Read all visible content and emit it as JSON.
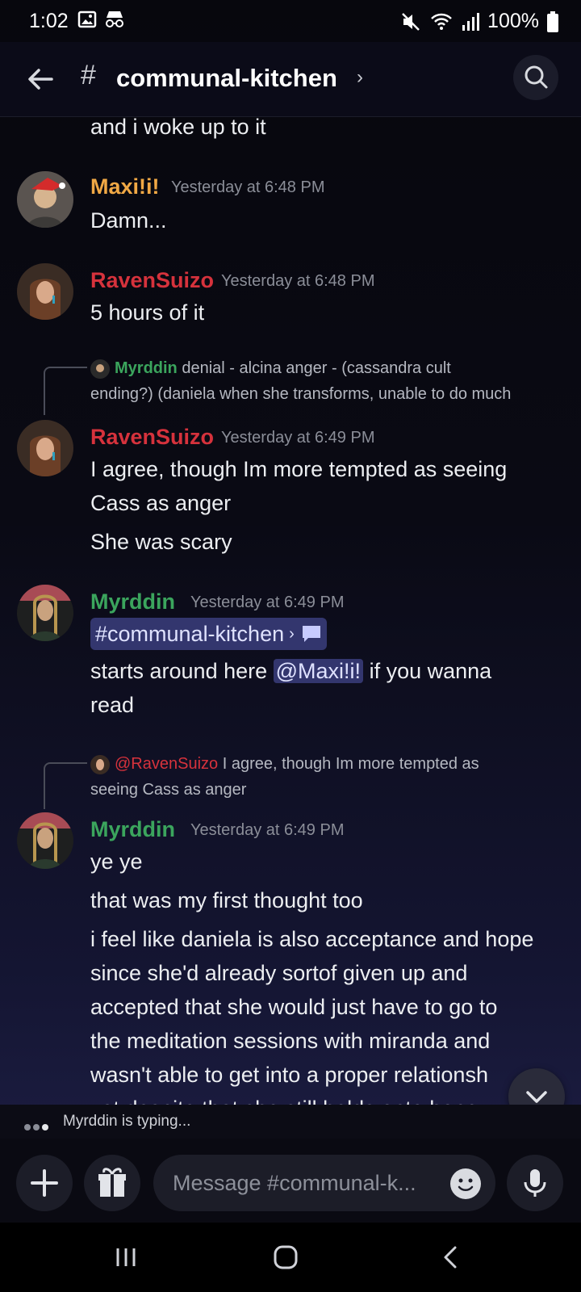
{
  "status": {
    "time": "1:02",
    "battery": "100%"
  },
  "header": {
    "channel": "communal-kitchen"
  },
  "messages": {
    "cont": "and i woke up to it",
    "m1": {
      "author": "Maxi!i!",
      "time": "Yesterday at 6:48 PM",
      "text": "Damn...",
      "color": "#f0a845"
    },
    "m2": {
      "author": "RavenSuizo",
      "time": "Yesterday at 6:48 PM",
      "text": "5 hours of it",
      "color": "#d6323c"
    },
    "r1": {
      "author": "Myrddin",
      "text1": "denial - alcina anger -  (cassandra cult",
      "text2": "ending?) (daniela when she transforms, unable to do much"
    },
    "m3": {
      "author": "RavenSuizo",
      "time": "Yesterday at 6:49 PM",
      "line1": "I agree, though Im more tempted as seeing",
      "line2": "Cass as anger",
      "line3": "She was scary"
    },
    "m4": {
      "author": "Myrddin",
      "time": "Yesterday at 6:49 PM",
      "channel_link": "#communal-kitchen",
      "line1_pre": "starts around here",
      "mention": "@Maxi!i!",
      "line1_post": "if you wanna",
      "line2": "read",
      "color": "#3ba55d"
    },
    "r2": {
      "mention": "@RavenSuizo",
      "text1": "I agree, though Im more tempted as",
      "text2": "seeing Cass as anger"
    },
    "m5": {
      "author": "Myrddin",
      "time": "Yesterday at 6:49 PM",
      "line1": "ye ye",
      "line2": "that was my first thought too",
      "line3": "i feel like daniela is also acceptance and hope",
      "line4": "since she'd already sortof given up and",
      "line5": "accepted that she would just have to go to",
      "line6": "the meditation sessions with miranda and",
      "line7": "wasn't able to get into a proper relationsh",
      "line8": "yet despite that she still holds onto hope"
    }
  },
  "typing": {
    "text": "Myrddin is typing..."
  },
  "composer": {
    "placeholder": "Message #communal-k..."
  }
}
